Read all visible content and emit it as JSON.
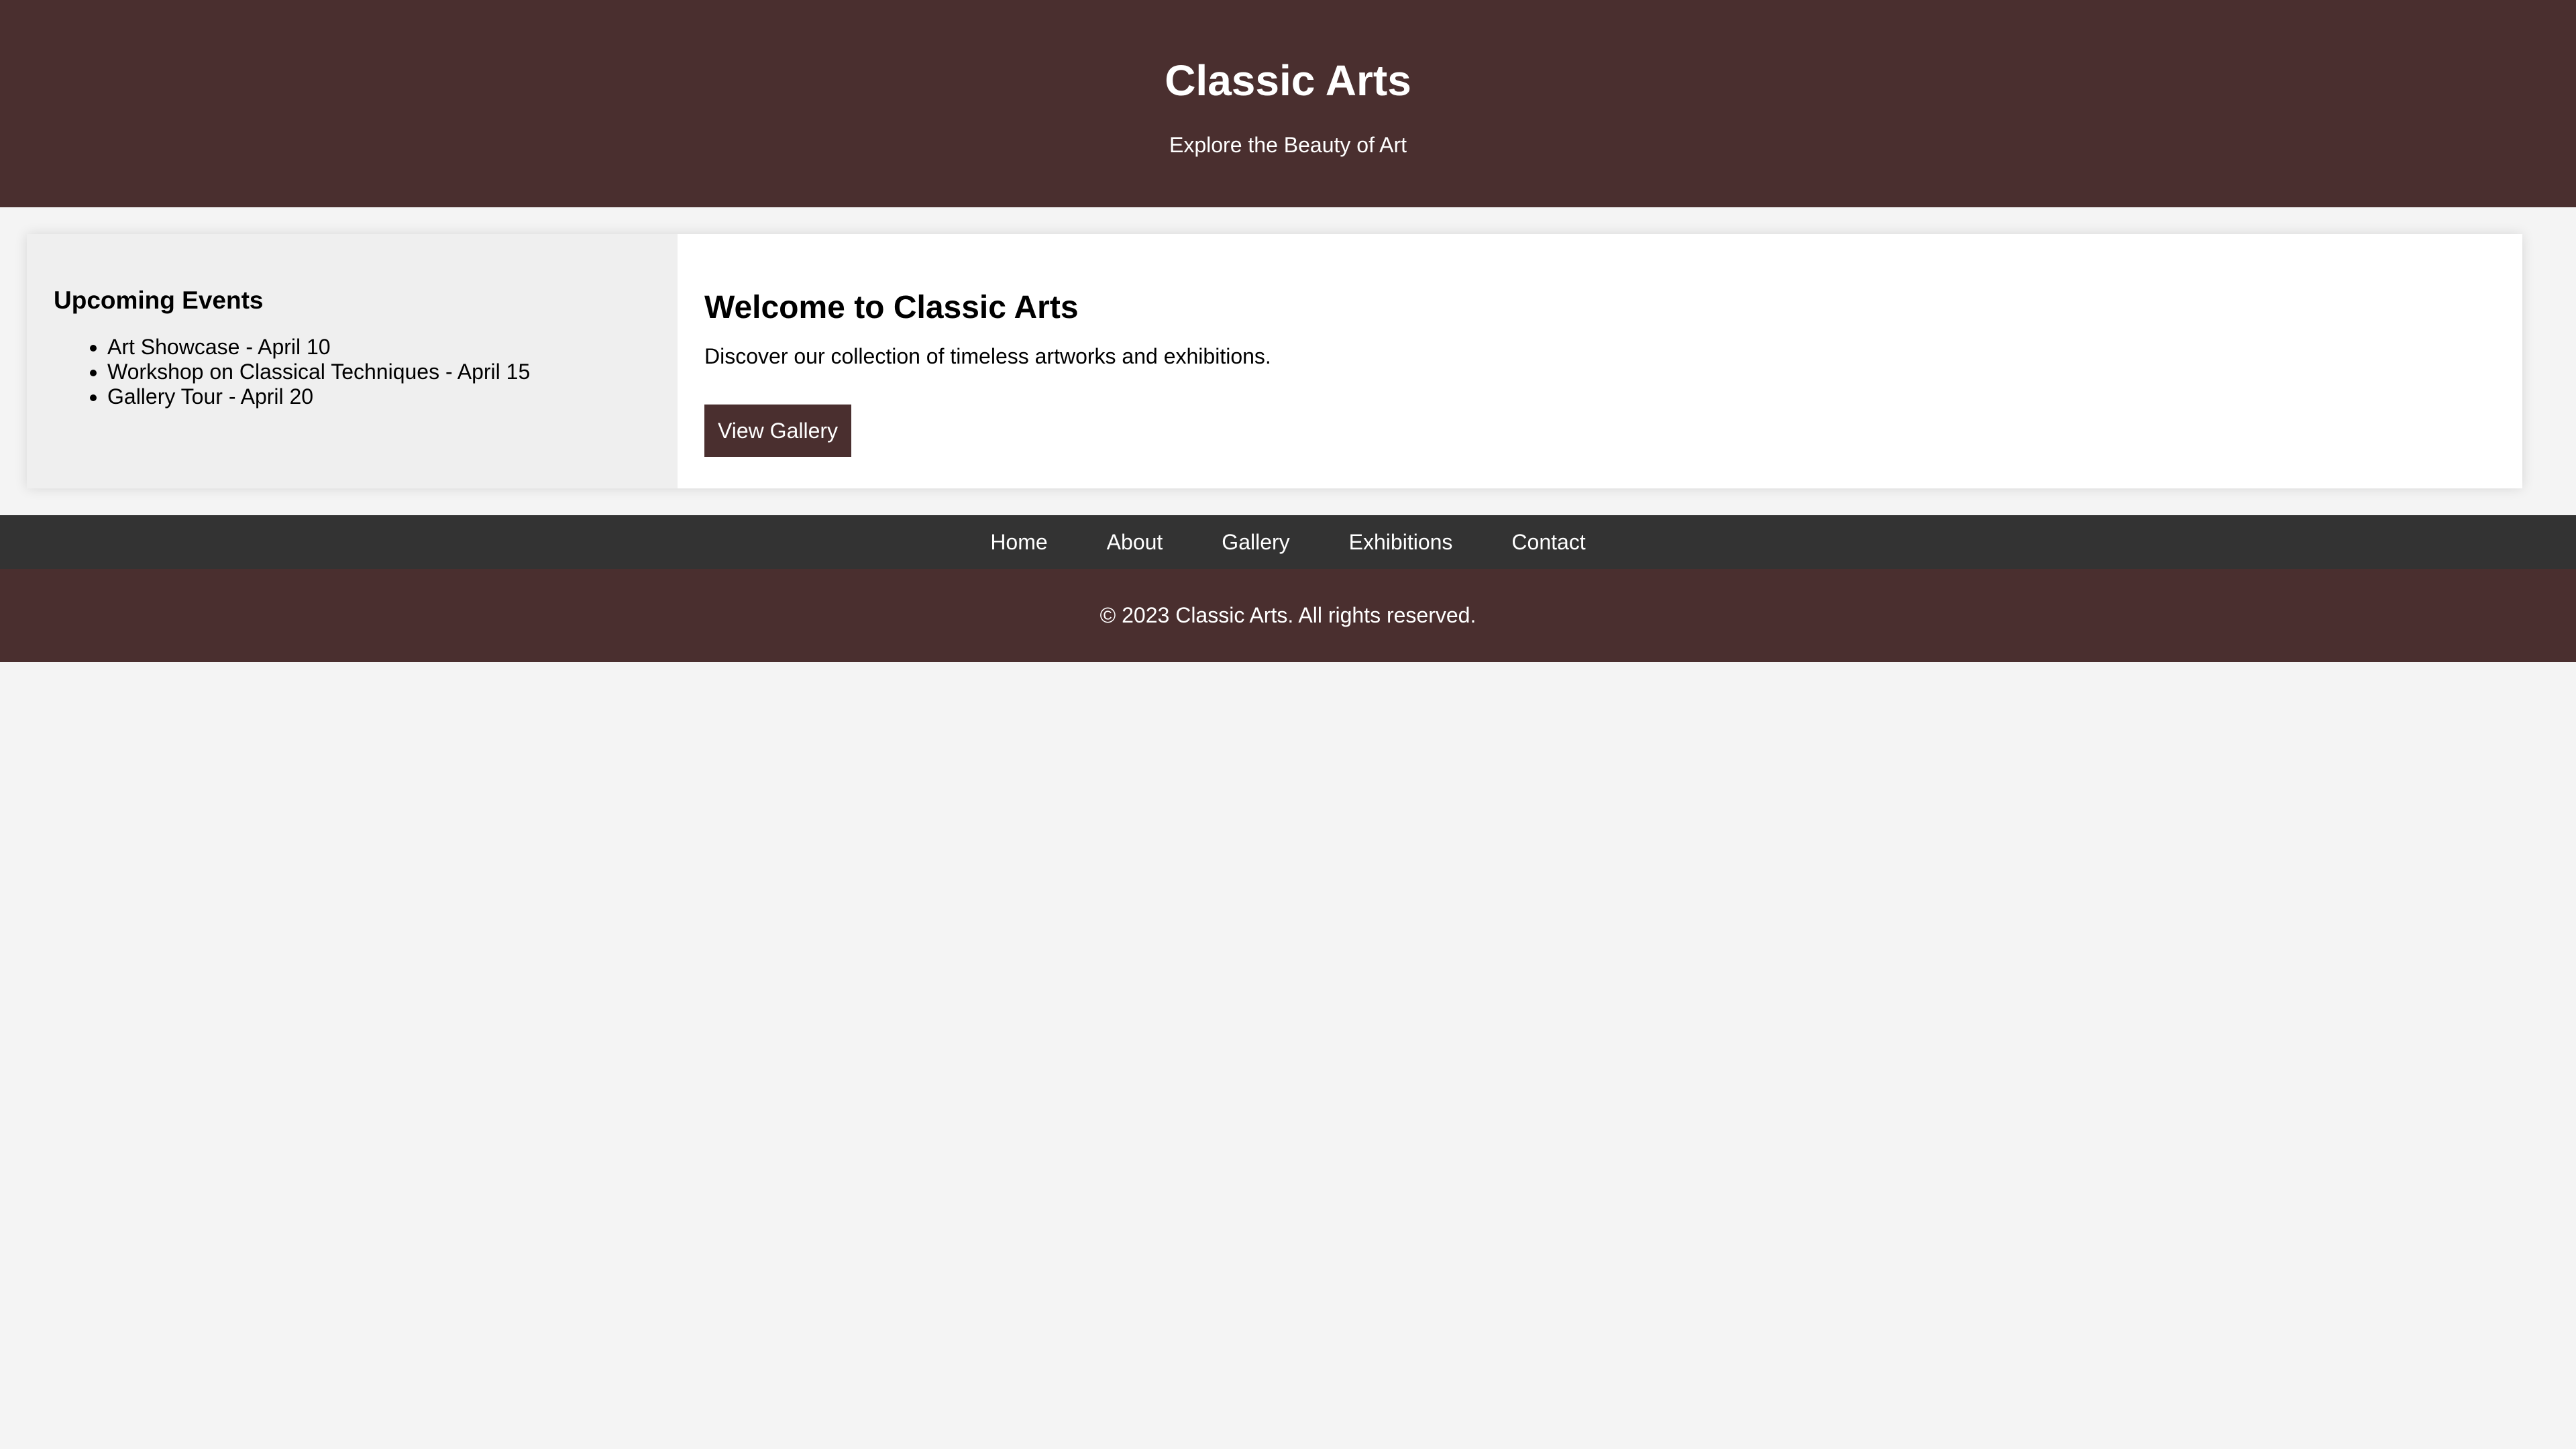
{
  "header": {
    "title": "Classic Arts",
    "tagline": "Explore the Beauty of Art"
  },
  "sidebar": {
    "heading": "Upcoming Events",
    "events": [
      "Art Showcase - April 10",
      "Workshop on Classical Techniques - April 15",
      "Gallery Tour - April 20"
    ]
  },
  "main": {
    "title": "Welcome to Classic Arts",
    "description": "Discover our collection of timeless artworks and exhibitions.",
    "button_label": "View Gallery"
  },
  "nav": {
    "items": [
      "Home",
      "About",
      "Gallery",
      "Exhibitions",
      "Contact"
    ]
  },
  "footer": {
    "copyright": "© 2023 Classic Arts. All rights reserved."
  },
  "colors": {
    "brand": "#4a2f2f",
    "nav_background": "#333333",
    "page_background": "#f4f4f4",
    "sidebar_background": "#efefef"
  }
}
